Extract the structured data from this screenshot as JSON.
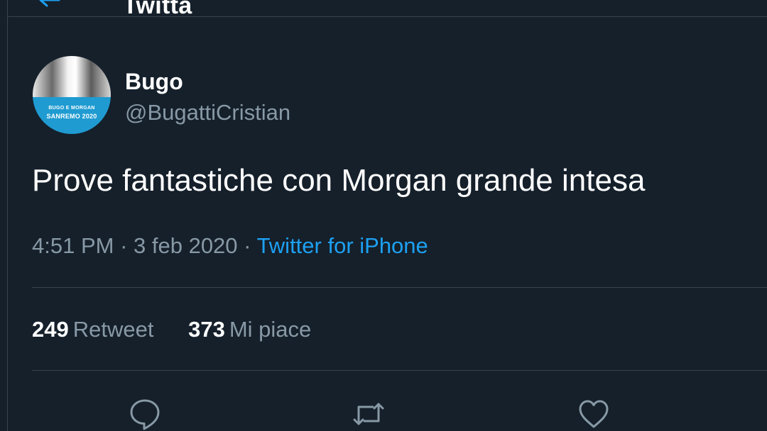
{
  "header": {
    "title": "Twitta"
  },
  "tweet": {
    "author_name": "Bugo",
    "author_handle": "@BugattiCristian",
    "avatar_text": {
      "line1": "BUGO E MORGAN",
      "line2": "SANREMO 2020"
    },
    "text": "Prove fantastiche con Morgan grande intesa",
    "time": "4:51 PM",
    "date": "3 feb 2020",
    "source": "Twitter for iPhone"
  },
  "stats": {
    "retweets_count": "249",
    "retweets_label": "Retweet",
    "likes_count": "373",
    "likes_label": "Mi piace"
  },
  "actions": {
    "icons": [
      "reply-icon",
      "retweet-icon",
      "like-icon"
    ]
  },
  "colors": {
    "background": "#15202b",
    "divider": "#38444d",
    "secondary_text": "#8899a6",
    "link": "#1da1f2"
  }
}
